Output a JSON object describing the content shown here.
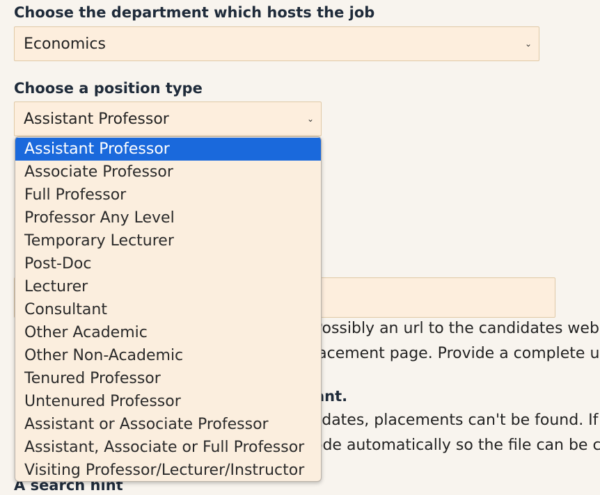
{
  "department": {
    "label": "Choose the department which hosts the job",
    "value": "Economics"
  },
  "position": {
    "label": "Choose a position type",
    "value": "Assistant Professor",
    "options": [
      "Assistant Professor",
      "Associate Professor",
      "Full Professor",
      "Professor Any Level",
      "Temporary Lecturer",
      "Post-Doc",
      "Lecturer",
      "Consultant",
      "Other Academic",
      "Other Non-Academic",
      "Tenured Professor",
      "Untenured Professor",
      "Assistant or Associate Professor",
      "Assistant, Associate or Full Professor",
      "Visiting Professor/Lecturer/Instructor"
    ],
    "selected_index": 0
  },
  "background": {
    "line1": "Possibly an url to the candidates webpa",
    "line2": "lacement page. Provide a complete ur",
    "line3": "ant.",
    "line4": "lidates, placements can't be found. If y",
    "line5": "ode automatically so the file can be ch",
    "search_hint": "A search hint"
  }
}
